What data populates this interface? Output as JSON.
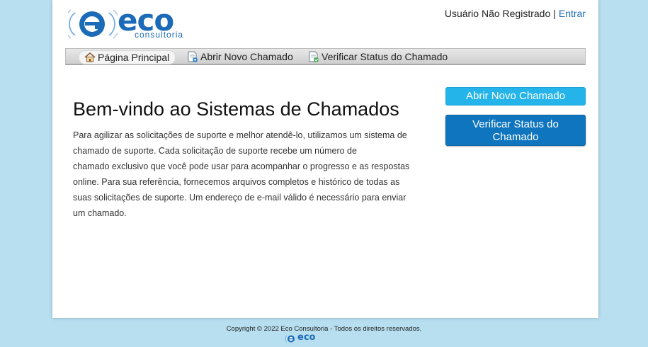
{
  "header": {
    "logo_text": "eco",
    "logo_subtitle": "consultoria",
    "user_status": "Usuário Não Registrado",
    "separator": "|",
    "login_link": "Entrar"
  },
  "nav": {
    "items": [
      {
        "label": "Página Principal",
        "icon": "home-icon",
        "active": true
      },
      {
        "label": "Abrir Novo Chamado",
        "icon": "new-ticket-icon",
        "active": false
      },
      {
        "label": "Verificar Status do Chamado",
        "icon": "ticket-status-icon",
        "active": false
      }
    ]
  },
  "main": {
    "title": "Bem-vindo ao Sistemas de Chamados",
    "body_lines": [
      "Para agilizar as solicitações de suporte e melhor atendê-lo, utilizamos um sistema de",
      "chamado de suporte. Cada solicitação de suporte recebe um número de",
      "chamado exclusivo que você pode usar para acompanhar o progresso e as respostas",
      "online. Para sua referência, fornecemos arquivos completos e histórico de todas as",
      "suas solicitações de suporte. Um endereço de e-mail válido é necessário para enviar",
      "um chamado."
    ]
  },
  "sidebar": {
    "open_ticket_label": "Abrir Novo Chamado",
    "check_status_line1": "Verificar Status do",
    "check_status_line2": "Chamado"
  },
  "footer": {
    "copyright": "Copyright © 2022 Eco Consultoria - Todos os direitos reservados.",
    "logo_text": "eco"
  },
  "colors": {
    "page_background": "#b7dff0",
    "brand_blue": "#1b6bb8",
    "button_light_blue": "#24b4ea",
    "button_dark_blue": "#0f75be"
  }
}
